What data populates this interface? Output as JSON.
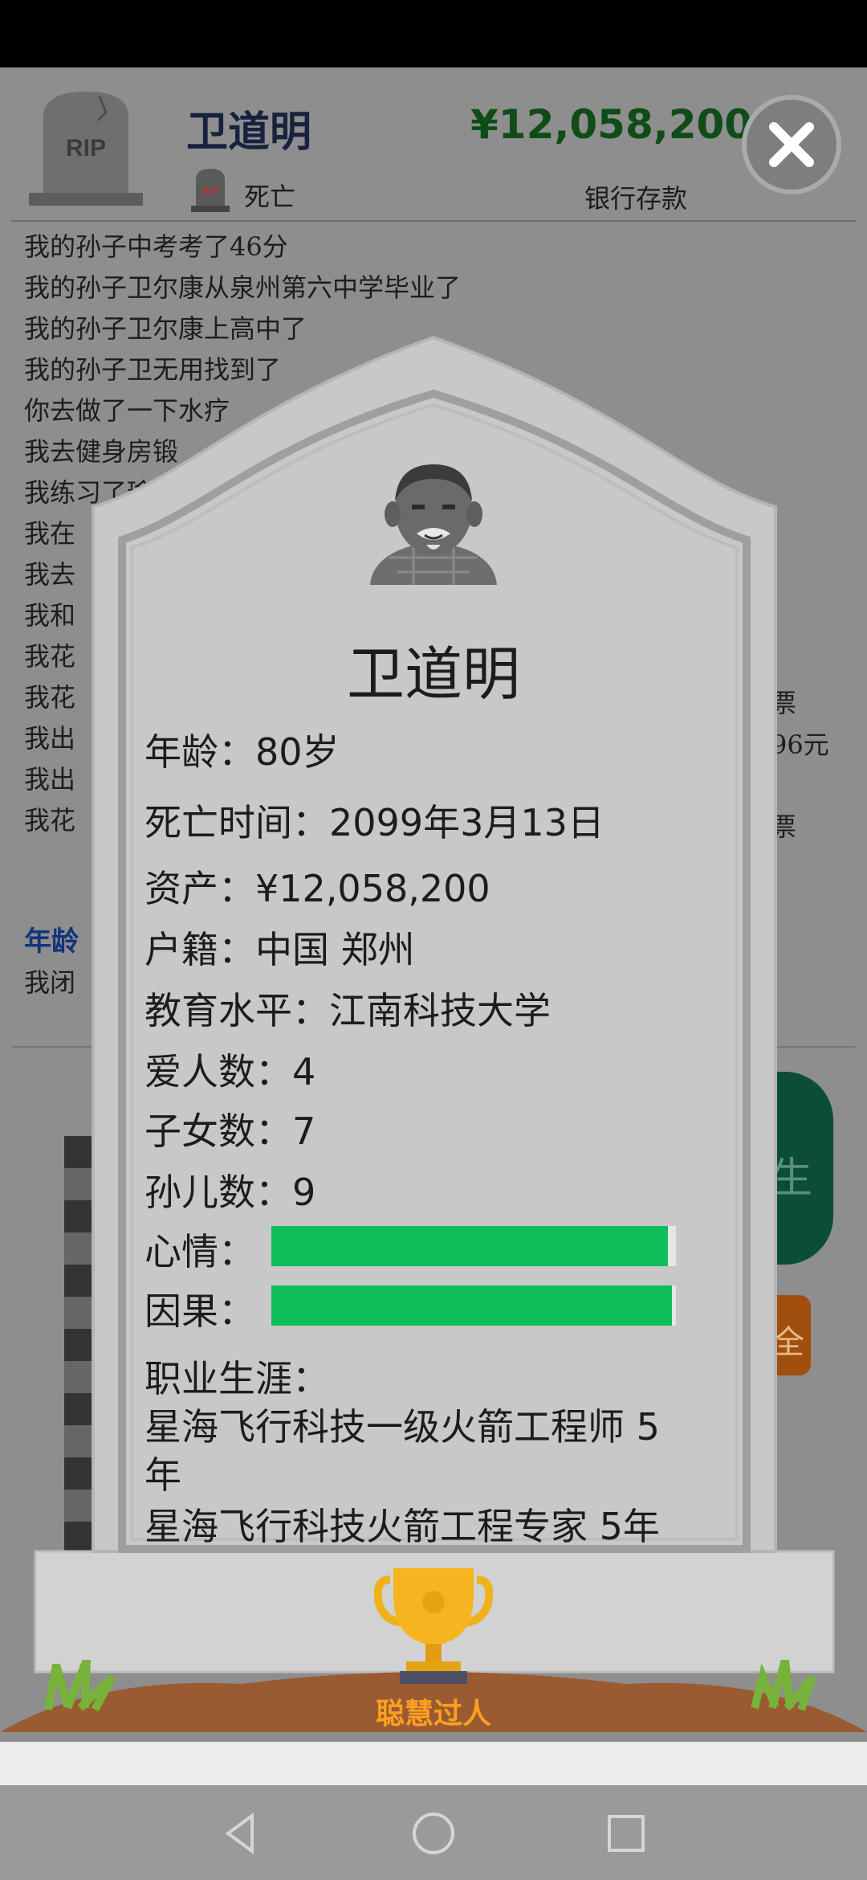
{
  "header": {
    "name": "卫道明",
    "status": "死亡",
    "money": "¥12,058,200",
    "money_label": "银行存款",
    "rip_text": "RIP"
  },
  "log": {
    "lines": [
      "我的孙子中考考了46分",
      "我的孙子卫尔康从泉州第六中学毕业了",
      "我的孙子卫尔康上高中了",
      "我的孙子卫无用找到了",
      "你去做了一下水疗",
      "我去健身房锻",
      "我练习了瑜",
      "我在",
      "我去",
      "我和",
      "我花",
      "我花",
      "我出",
      "我出",
      "我花"
    ],
    "right_fragments": [
      "票",
      "96元",
      "票"
    ],
    "age_label": "年龄",
    "age_line": "我闭"
  },
  "background_buttons": {
    "green_fragment": "生",
    "orange_fragment": "全"
  },
  "tombstone": {
    "name": "卫道明",
    "age": "年龄：80岁",
    "death_time": "死亡时间：2099年3月13日",
    "assets": "资产：¥12,058,200",
    "hometown": "户籍：中国 郑州",
    "education": "教育水平：江南科技大学",
    "spouses": "爱人数：4",
    "children": "子女数：7",
    "grandchildren": "孙儿数：9",
    "mood_label": "心情：",
    "mood_level": 0.98,
    "karma_label": "因果：",
    "karma_level": 0.99,
    "career_label": "职业生涯：",
    "career_1": "星海飞行科技一级火箭工程师 5年",
    "career_2": "星海飞行科技火箭工程专家 5年",
    "trophy_label": "聪慧过人"
  },
  "colors": {
    "bar_green": "#0fbd5a",
    "trophy_text": "#ff9f20",
    "money_green": "#0f4c18",
    "age_label_blue": "#12357a"
  },
  "icons": {
    "close": "close-icon",
    "rip": "tombstone-icon",
    "avatar": "avatar-old-man",
    "trophy": "trophy-icon",
    "nav_back": "back-icon",
    "nav_home": "home-icon",
    "nav_recents": "recents-icon"
  }
}
